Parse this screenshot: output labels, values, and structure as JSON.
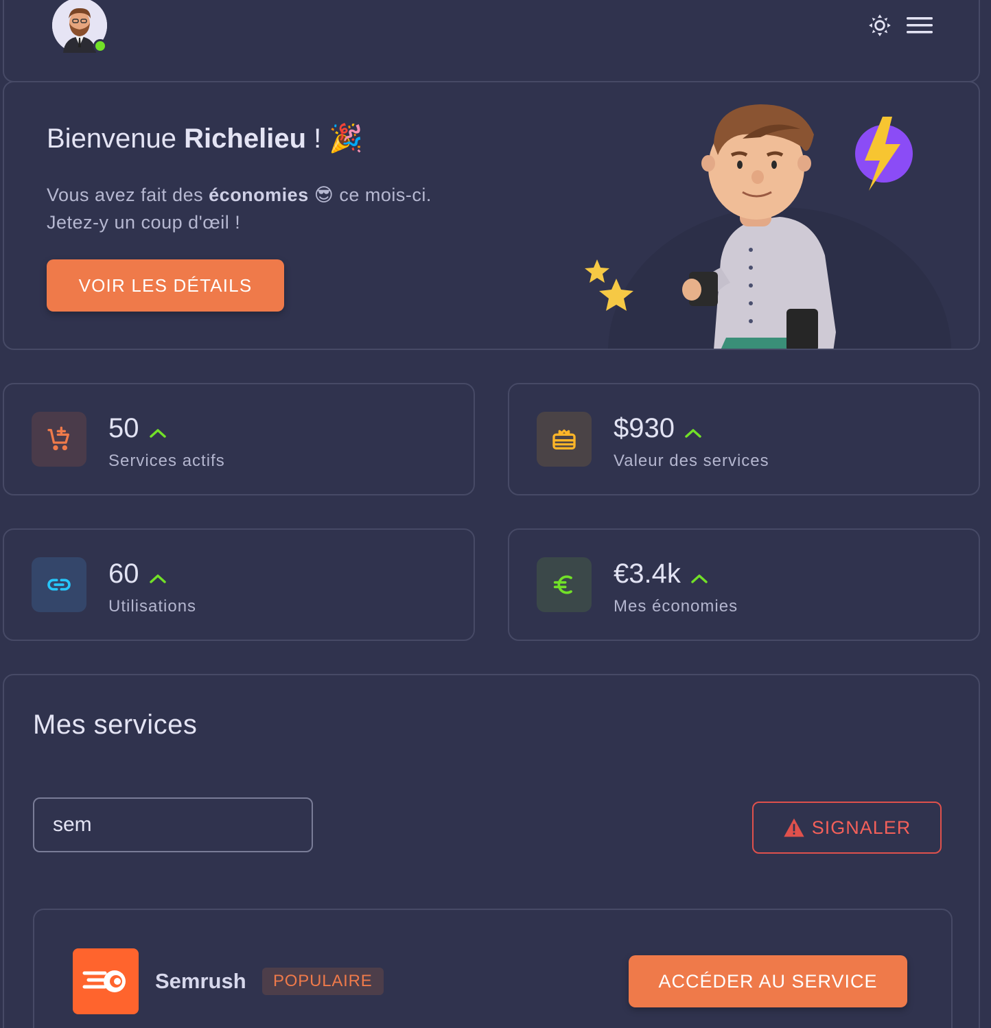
{
  "header": {
    "avatar_status": "online",
    "theme_icon": "sun-icon",
    "menu_icon": "hamburger-menu-icon"
  },
  "welcome": {
    "greeting": "Bienvenue",
    "name": "Richelieu",
    "exclaim": "!",
    "title_emoji": "🎉",
    "line1_before": "Vous avez fait des",
    "line1_bold": "économies",
    "line1_emoji": "😎",
    "line1_after": "ce mois-ci.",
    "line2": "Jetez-y un coup d'œil !",
    "button": "VOIR LES DÉTAILS"
  },
  "stats": [
    {
      "value": "50",
      "label": "Services actifs",
      "icon": "cart-plus-icon",
      "color": "#ef7a4a",
      "trend": "up"
    },
    {
      "value": "$930",
      "label": "Valeur des services",
      "icon": "gift-card-icon",
      "color": "#fdb528",
      "trend": "up"
    },
    {
      "value": "60",
      "label": "Utilisations",
      "icon": "link-icon",
      "color": "#26c6f9",
      "trend": "up"
    },
    {
      "value": "€3.4k",
      "label": "Mes économies",
      "icon": "euro-icon",
      "color": "#72e128",
      "trend": "up"
    }
  ],
  "services": {
    "title": "Mes services",
    "search_value": "sem",
    "report_button": "SIGNALER",
    "items": [
      {
        "name": "Semrush",
        "badge": "POPULAIRE",
        "button": "ACCÉDER AU SERVICE",
        "brand_color": "#ff642d"
      }
    ]
  },
  "colors": {
    "background": "#30334e",
    "primary": "#ef7a4a",
    "danger": "#e0514c",
    "success": "#72e128"
  }
}
